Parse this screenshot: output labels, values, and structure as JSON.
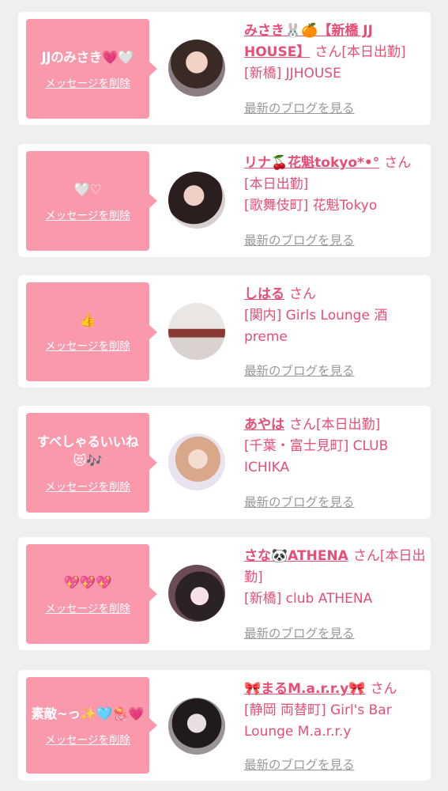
{
  "colors": {
    "page_bg": "#efefef",
    "card_bg": "#ffffff",
    "bubble": "#fb99ac",
    "accent_text": "#e84d76",
    "blog_link": "#999999"
  },
  "items": [
    {
      "message": "JJのみさき💗🤍",
      "delete_label": "メッセージを削除",
      "name": "みさき🐰🍊【新橋 JJ HOUSE】",
      "suffix": "さん",
      "status": "[本日出勤]",
      "shop": "[新橋] JJHOUSE",
      "blog_label": "最新のブログを見る",
      "avatar_icon": "avatar-photo"
    },
    {
      "message": "🤍♡",
      "delete_label": "メッセージを削除",
      "name": "リナ🍒花魁tokyo*•°",
      "suffix": "さん",
      "status": "[本日出勤]",
      "shop": "[歌舞伎町] 花魁Tokyo",
      "blog_label": "最新のブログを見る",
      "avatar_icon": "avatar-photo"
    },
    {
      "message": "👍",
      "delete_label": "メッセージを削除",
      "name": "しはる",
      "suffix": "さん",
      "status": "",
      "shop": "[関内] Girls Lounge 酒preme",
      "blog_label": "最新のブログを見る",
      "avatar_icon": "avatar-photo"
    },
    {
      "message": "すべしゃるいいね😻🎶",
      "delete_label": "メッセージを削除",
      "name": "あやは",
      "suffix": "さん",
      "status": "[本日出勤]",
      "shop": "[千葉・富士見町] CLUB ICHIKA",
      "blog_label": "最新のブログを見る",
      "avatar_icon": "avatar-photo"
    },
    {
      "message": "💖💖💖",
      "delete_label": "メッセージを削除",
      "name": "さな🐼ATHENA",
      "suffix": "さん",
      "status": "[本日出勤]",
      "shop": "[新橋] club ATHENA",
      "blog_label": "最新のブログを見る",
      "avatar_icon": "avatar-photo"
    },
    {
      "message": "素敵~っ✨🩵🪼💗",
      "delete_label": "メッセージを削除",
      "name": "🎀まるM.a.r.r.y🎀",
      "suffix": "さん",
      "status": "",
      "shop": "[静岡 両替町] Girl's Bar Lounge M.a.r.r.y",
      "blog_label": "最新のブログを見る",
      "avatar_icon": "avatar-photo"
    }
  ]
}
